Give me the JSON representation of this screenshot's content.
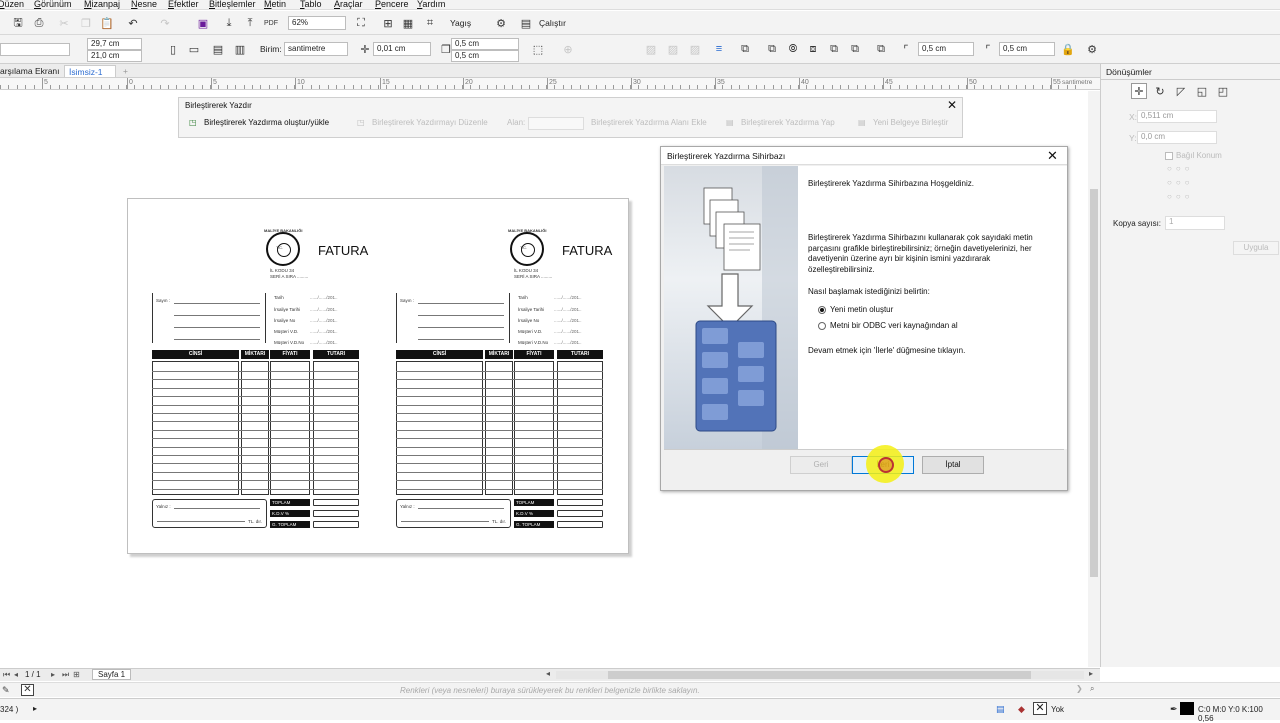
{
  "menu": [
    "Düzen",
    "Görünüm",
    "Mizanpaj",
    "Nesne",
    "Efektler",
    "Bitleşlemler",
    "Metin",
    "Tablo",
    "Araçlar",
    "Pencere",
    "Yardım"
  ],
  "toolbar": {
    "zoom": "62%",
    "publish_label": "Yagış",
    "launch_label": "Çalıştır"
  },
  "propbar": {
    "width": "29,7 cm",
    "height": "21,0 cm",
    "unit_label": "Birim:",
    "unit_value": "santimetre",
    "nudge": "0,01 cm",
    "dup_x": "0,5 cm",
    "dup_y": "0,5 cm",
    "margin_a": "0,5 cm",
    "margin_b": "0,5 cm"
  },
  "tabs": [
    "arşılama Ekranı",
    "İsimsiz-1"
  ],
  "ruler": {
    "labels": [
      "5",
      "0",
      "5",
      "10",
      "15",
      "20",
      "25",
      "30",
      "35",
      "40",
      "45",
      "50",
      "55"
    ],
    "unit": "santimetre"
  },
  "merge_toolbar": {
    "title": "Birleştirerek Yazdır",
    "items": [
      "Birleştirerek Yazdırma oluştur/yükle",
      "Birleştirerek Yazdırmayı Düzenle",
      "Alan:",
      "Birleştirerek Yazdırma Alanı Ekle",
      "Birleştirerek Yazdırma Yap",
      "Yeni Belgeye Birleştir"
    ]
  },
  "invoice": {
    "title": "FATURA",
    "seal_text": "MALİYE BAKANLIĞI",
    "seal_center": "T.C.",
    "code_line": "İL KODU 34",
    "serial_line": "SERİ A SIRA .........",
    "customer_label": "Sayın :",
    "fields": [
      "Tarih",
      "İrsaliye Tarihi",
      "İrsaliye No",
      "Müşteri V.D.",
      "Müşteri V.D.No"
    ],
    "field_value": "....../....../201..",
    "columns": [
      "CİNSİ",
      "MİKTARI",
      "FİYATI",
      "TUTARI"
    ],
    "yaziyla": "Yalnız :",
    "tl_label": "TL. dır.",
    "totals": [
      "TOPLAM",
      "K.D.V %",
      "G. TOPLAM"
    ]
  },
  "wizard": {
    "title": "Birleştirerek Yazdırma Sihirbazı",
    "welcome": "Birleştirerek Yazdırma Sihirbazına Hoşgeldiniz.",
    "description": "Birleştirerek Yazdırma Sihirbazını kullanarak çok sayıdaki metin parçasını grafikle birleştirebilirsiniz; örneğin davetiyelerinizi, her davetiyenin üzerine ayrı bir kişinin ismini yazdırarak özelleştirebilirsiniz.",
    "how_start": "Nasıl başlamak istediğinizi belirtin:",
    "option1": "Yeni metin oluştur",
    "option2": "Metni bir ODBC veri kaynağından al",
    "continue_hint": "Devam etmek için 'İlerle' düğmesine tıklayın.",
    "back_label": "Geri",
    "next_label": "İleri",
    "cancel_label": "İptal"
  },
  "docker": {
    "title": "Dönüşümler",
    "x_value": "0,511 cm",
    "y_value": "0,0 cm",
    "relative_label": "Bağıl Konum",
    "copies_label": "Kopya sayısı:",
    "copies_value": "1",
    "apply_label": "Uygula"
  },
  "pages": {
    "counter": "1 / 1",
    "page_tab": "Sayfa 1"
  },
  "palette_hint": "Renkleri (veya nesneleri) buraya sürükleyerek bu renkleri belgenizle birlikte saklayın.",
  "status": {
    "left": "324 )",
    "fill_none": "Yok",
    "color_info": "C:0 M:0 Y:0 K:100  0,56"
  }
}
